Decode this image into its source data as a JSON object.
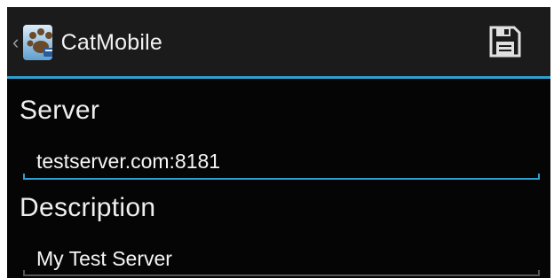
{
  "action_bar": {
    "title": "CatMobile",
    "up_glyph": "‹",
    "app_icon": "cat-paw-app-icon",
    "save_icon": "floppy-disk-save-icon"
  },
  "form": {
    "server_label": "Server",
    "server_value": "testserver.com:8181",
    "description_label": "Description",
    "description_value": "My Test Server"
  },
  "colors": {
    "accent": "#2e9fd0",
    "background": "#050505",
    "action_bar_bg": "#1b1b1b"
  }
}
